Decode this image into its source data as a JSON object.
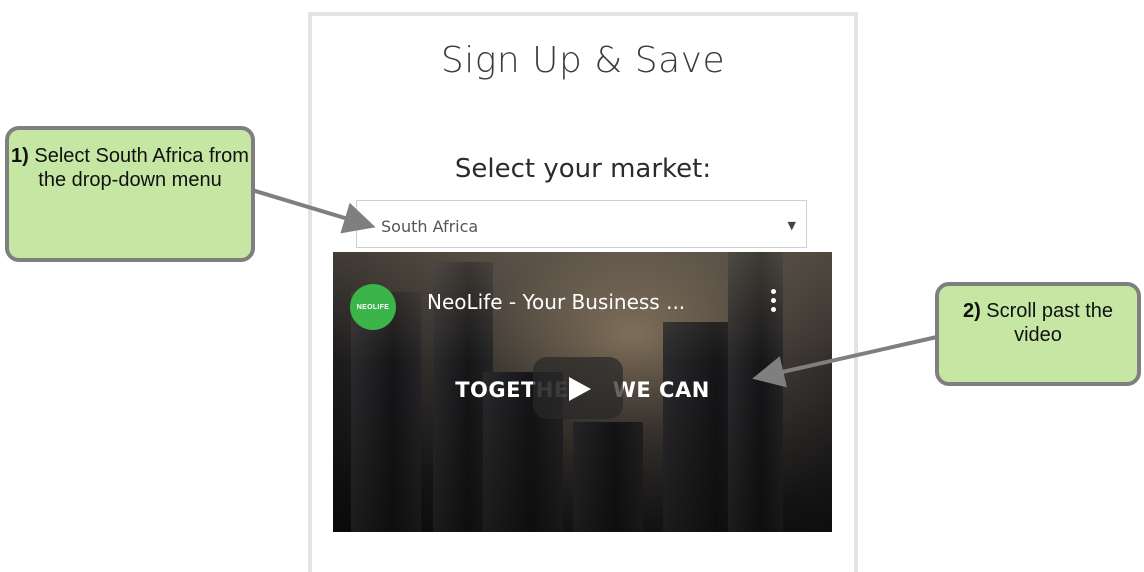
{
  "form": {
    "title": "Sign Up & Save",
    "market_label": "Select your market:",
    "market_selected": "South Africa"
  },
  "video": {
    "channel_logo_text": "NEOLIFE",
    "title": "NeoLife - Your Business ...",
    "overlay_text_left": "TOGET",
    "overlay_text_faded": "HE",
    "overlay_text_right": "WE CAN"
  },
  "callouts": {
    "step1_num": "1)",
    "step1_text": " Select South Africa from the drop-down menu",
    "step2_num": "2)",
    "step2_text": " Scroll past the video"
  },
  "colors": {
    "callout_fill": "#c6e6a4",
    "callout_border": "#7f7f7f",
    "logo_green": "#3bb54a"
  }
}
